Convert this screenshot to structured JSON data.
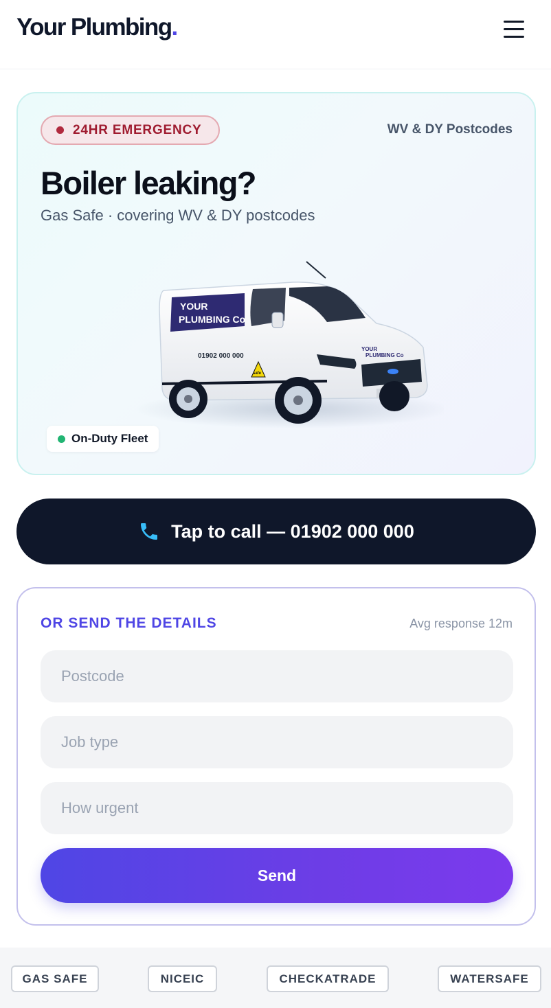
{
  "header": {
    "brand": "Your Plumbing",
    "brand_dot": ".",
    "menu_icon": "hamburger-menu-icon"
  },
  "hero": {
    "badge": "24HR EMERGENCY",
    "coverage": "WV & DY Postcodes",
    "title": "Boiler leaking?",
    "subtitle": "Gas Safe · covering WV & DY postcodes",
    "van": {
      "livery_line1": "YOUR",
      "livery_line2": "PLUMBING Co",
      "phone": "01902 000 000",
      "gas_safe": "safe"
    },
    "fleet_status": "On-Duty Fleet"
  },
  "call": {
    "icon": "phone-icon",
    "label": "Tap to call — 01902 000 000"
  },
  "form": {
    "heading": "OR SEND THE DETAILS",
    "response": "Avg response 12m",
    "postcode_placeholder": "Postcode",
    "job_type_placeholder": "Job type",
    "urgency_placeholder": "How urgent",
    "send_label": "Send"
  },
  "trust": [
    "GAS SAFE",
    "NICEIC",
    "CHECKATRADE",
    "WATERSAFE"
  ],
  "colors": {
    "brand_accent": "#4f46e5",
    "dark": "#0f172a",
    "emergency_red": "#9f1c30",
    "online_green": "#22b573"
  }
}
